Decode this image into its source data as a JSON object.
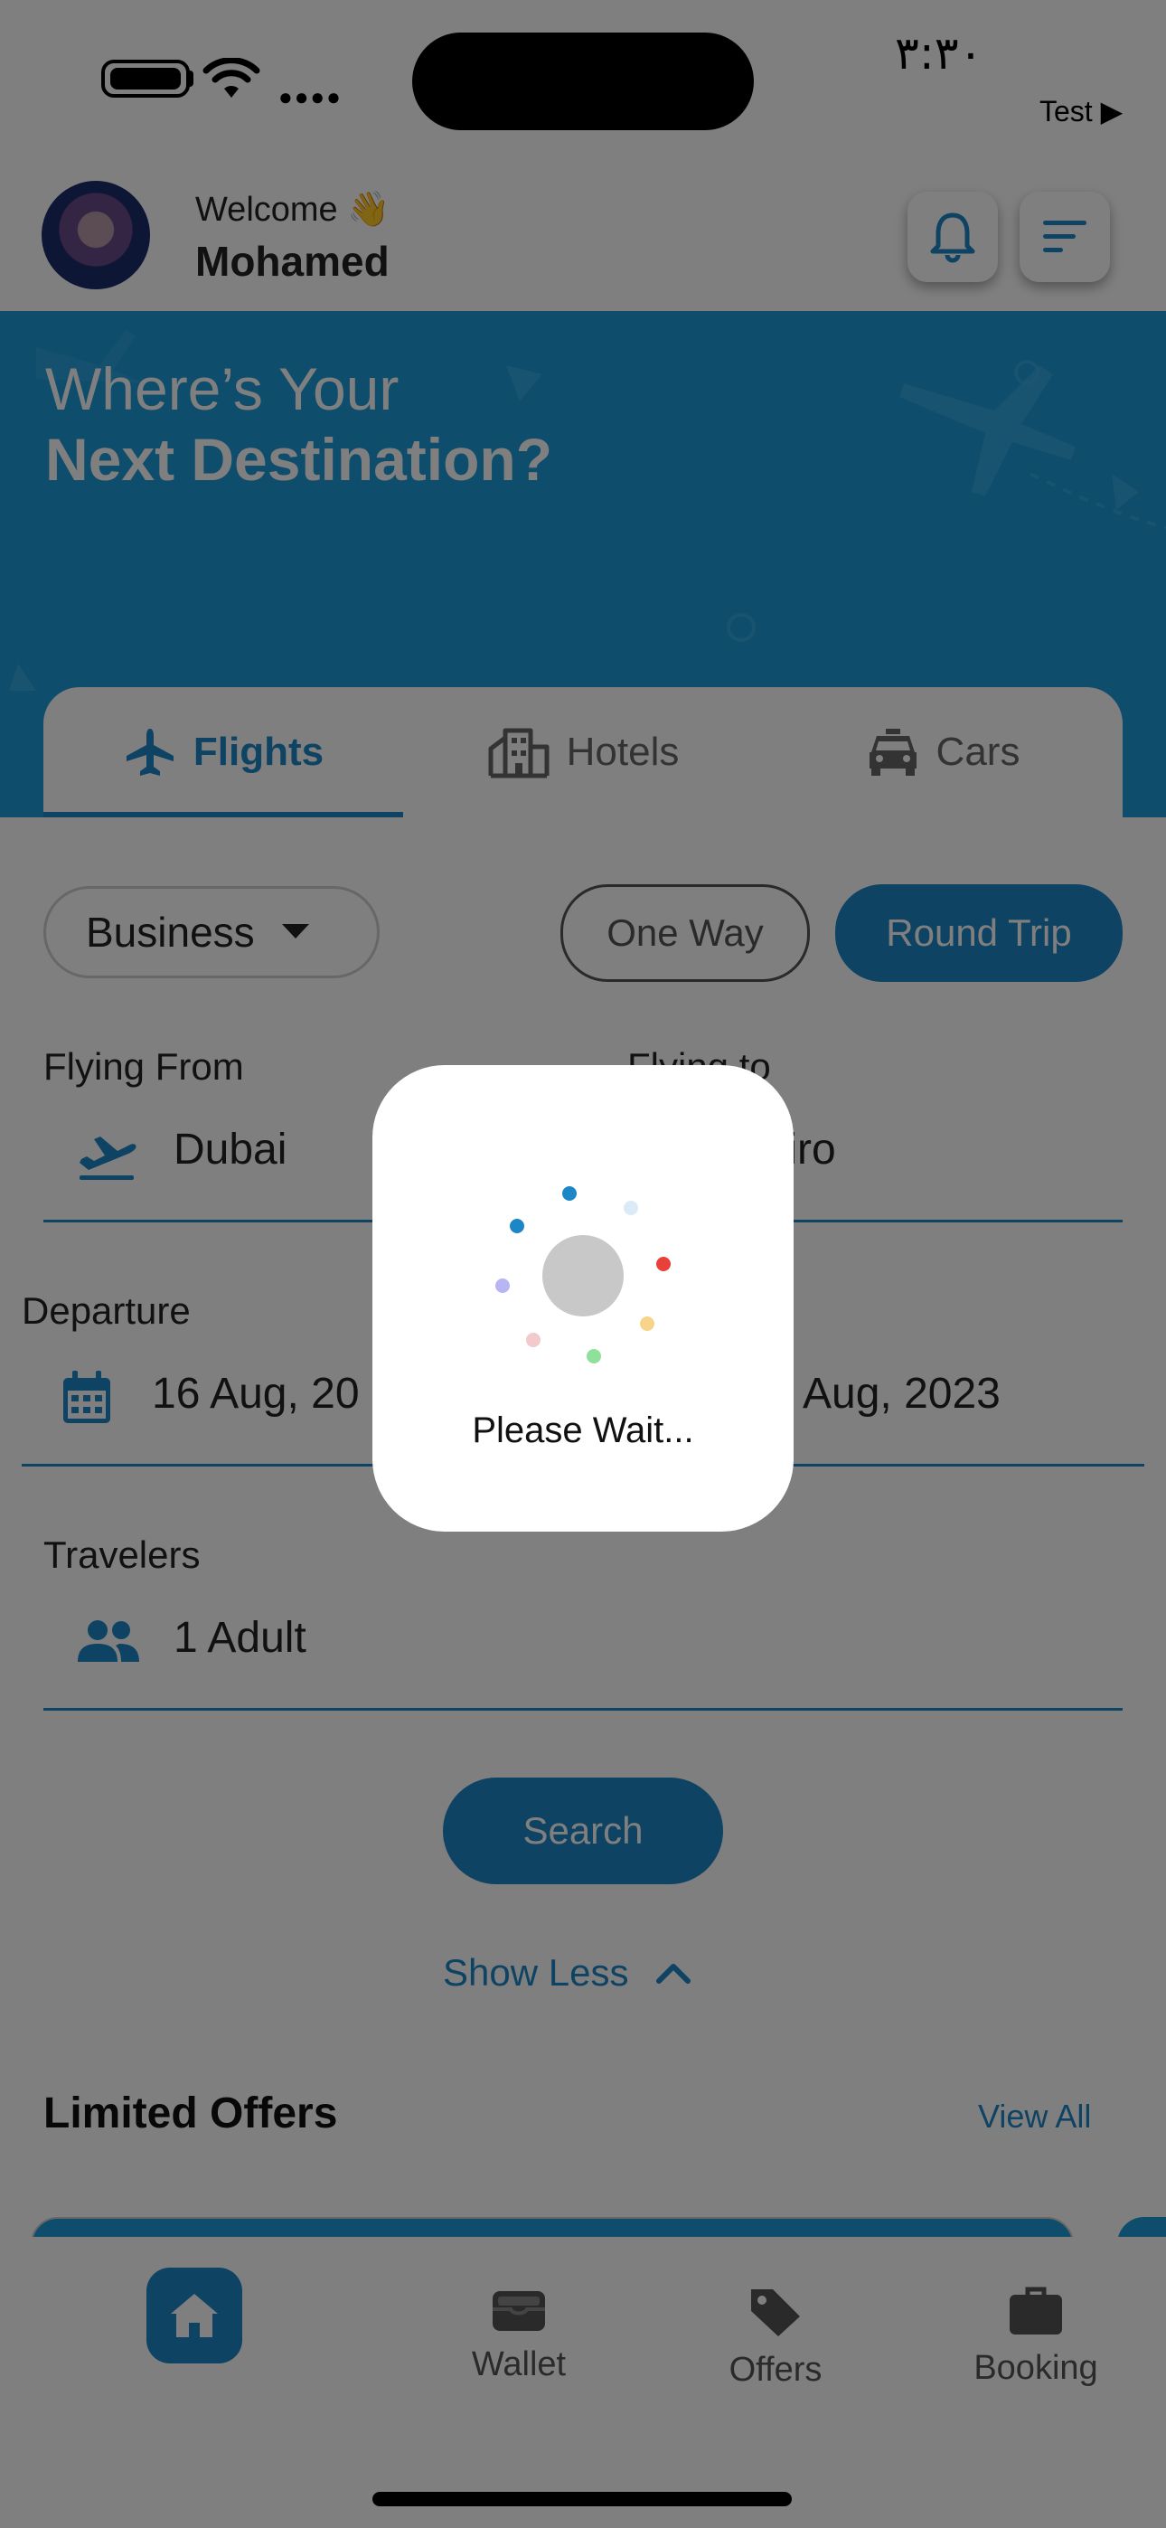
{
  "status_bar": {
    "time": "٣:٣٠",
    "back_label": "Test ▶"
  },
  "header": {
    "welcome": "Welcome 👋",
    "username": "Mohamed"
  },
  "hero": {
    "line1": "Where’s Your",
    "line2": "Next Destination?"
  },
  "tabs": [
    {
      "label": "Flights",
      "icon": "airplane-icon",
      "active": true
    },
    {
      "label": "Hotels",
      "icon": "hotel-icon",
      "active": false
    },
    {
      "label": "Cars",
      "icon": "car-icon",
      "active": false
    }
  ],
  "form": {
    "cabin_class": "Business",
    "trip_types": [
      "One Way",
      "Round Trip"
    ],
    "selected_trip_type": "Round Trip",
    "flying_from_label": "Flying From",
    "flying_from_value": "Dubai",
    "flying_to_label": "Flying to",
    "flying_to_value": "Cairo",
    "departure_label": "Departure",
    "departure_value": "16 Aug, 20",
    "return_value": "Aug, 2023",
    "travelers_label": "Travelers",
    "travelers_value": "1 Adult",
    "search_label": "Search",
    "show_less_label": "Show Less"
  },
  "offers": {
    "title": "Limited Offers",
    "view_all": "View All"
  },
  "bottom_nav": [
    {
      "label": "",
      "icon": "home-icon",
      "active": true
    },
    {
      "label": "Wallet",
      "icon": "wallet-icon"
    },
    {
      "label": "Offers",
      "icon": "tag-icon"
    },
    {
      "label": "Booking",
      "icon": "briefcase-icon"
    }
  ],
  "loading_dialog": {
    "message": "Please Wait..."
  },
  "colors": {
    "primary": "#1d86c6",
    "hero": "#1d9ad8",
    "overlay": "rgba(0,0,0,0.5)"
  }
}
